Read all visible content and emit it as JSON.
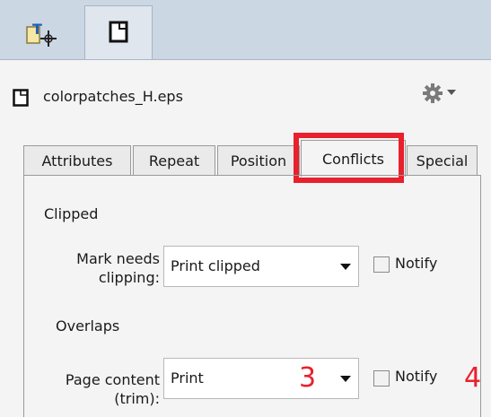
{
  "toolbar": {
    "buttons": [
      {
        "name": "text-mark-icon"
      },
      {
        "name": "page-icon"
      }
    ]
  },
  "file": {
    "name": "colorpatches_H.eps",
    "icon": "page-icon",
    "menu_icon": "gear-icon"
  },
  "tabs": [
    {
      "label": "Attributes",
      "active": false
    },
    {
      "label": "Repeat",
      "active": false
    },
    {
      "label": "Position",
      "active": false
    },
    {
      "label": "Conflicts",
      "active": true
    },
    {
      "label": "Special",
      "active": false
    }
  ],
  "conflicts": {
    "clipped_heading": "Clipped",
    "mark_needs_clipping": {
      "label_line1": "Mark needs",
      "label_line2": "clipping:",
      "value": "Print clipped",
      "notify_label": "Notify",
      "notify_checked": false
    },
    "overlaps_heading": "Overlaps",
    "page_content": {
      "label_line1": "Page content",
      "label_line2": "(trim):",
      "value": "Print",
      "notify_label": "Notify",
      "notify_checked": false
    }
  },
  "annotations": {
    "marker_3": "3",
    "marker_4": "4",
    "highlight_color": "#e8212d"
  }
}
